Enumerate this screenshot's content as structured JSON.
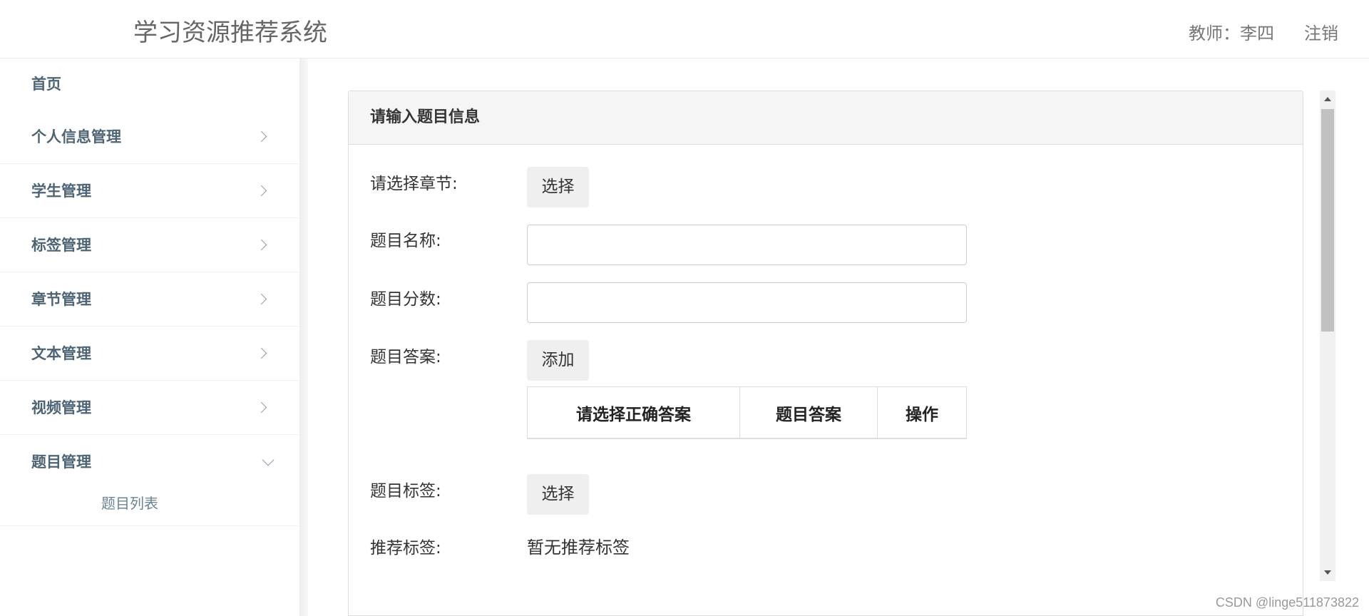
{
  "header": {
    "app_title": "学习资源推荐系统",
    "user_label": "教师：李四",
    "logout_label": "注销"
  },
  "sidebar": {
    "home": "首页",
    "items": [
      {
        "label": "个人信息管理",
        "icon": "chevron-right-icon"
      },
      {
        "label": "学生管理",
        "icon": "chevron-right-icon"
      },
      {
        "label": "标签管理",
        "icon": "chevron-right-icon"
      },
      {
        "label": "章节管理",
        "icon": "chevron-right-icon"
      },
      {
        "label": "文本管理",
        "icon": "chevron-right-icon"
      },
      {
        "label": "视频管理",
        "icon": "chevron-right-icon"
      },
      {
        "label": "题目管理",
        "icon": "chevron-down-icon",
        "expanded": true,
        "children": [
          {
            "label": "题目列表"
          }
        ]
      }
    ]
  },
  "form": {
    "title": "请输入题目信息",
    "chapter": {
      "label": "请选择章节:",
      "button": "选择"
    },
    "name": {
      "label": "题目名称:",
      "value": ""
    },
    "score": {
      "label": "题目分数:",
      "value": ""
    },
    "answer": {
      "label": "题目答案:",
      "button": "添加",
      "columns": [
        "请选择正确答案",
        "题目答案",
        "操作"
      ]
    },
    "tags": {
      "label": "题目标签:",
      "button": "选择"
    },
    "recommend": {
      "label": "推荐标签:",
      "value": "暂无推荐标签"
    }
  },
  "watermark": "CSDN @linge511873822",
  "colors": {
    "nav_text": "#4d6474",
    "panel_header_bg": "#f5f5f5",
    "button_bg": "#efefef"
  }
}
